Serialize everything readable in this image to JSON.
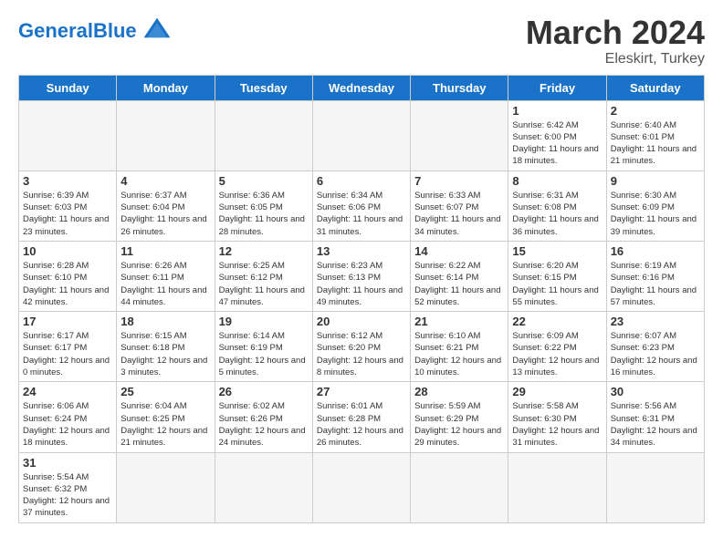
{
  "header": {
    "logo_general": "General",
    "logo_blue": "Blue",
    "month_title": "March 2024",
    "location": "Eleskirt, Turkey"
  },
  "days_of_week": [
    "Sunday",
    "Monday",
    "Tuesday",
    "Wednesday",
    "Thursday",
    "Friday",
    "Saturday"
  ],
  "weeks": [
    [
      {
        "day": "",
        "info": ""
      },
      {
        "day": "",
        "info": ""
      },
      {
        "day": "",
        "info": ""
      },
      {
        "day": "",
        "info": ""
      },
      {
        "day": "",
        "info": ""
      },
      {
        "day": "1",
        "info": "Sunrise: 6:42 AM\nSunset: 6:00 PM\nDaylight: 11 hours and 18 minutes."
      },
      {
        "day": "2",
        "info": "Sunrise: 6:40 AM\nSunset: 6:01 PM\nDaylight: 11 hours and 21 minutes."
      }
    ],
    [
      {
        "day": "3",
        "info": "Sunrise: 6:39 AM\nSunset: 6:03 PM\nDaylight: 11 hours and 23 minutes."
      },
      {
        "day": "4",
        "info": "Sunrise: 6:37 AM\nSunset: 6:04 PM\nDaylight: 11 hours and 26 minutes."
      },
      {
        "day": "5",
        "info": "Sunrise: 6:36 AM\nSunset: 6:05 PM\nDaylight: 11 hours and 28 minutes."
      },
      {
        "day": "6",
        "info": "Sunrise: 6:34 AM\nSunset: 6:06 PM\nDaylight: 11 hours and 31 minutes."
      },
      {
        "day": "7",
        "info": "Sunrise: 6:33 AM\nSunset: 6:07 PM\nDaylight: 11 hours and 34 minutes."
      },
      {
        "day": "8",
        "info": "Sunrise: 6:31 AM\nSunset: 6:08 PM\nDaylight: 11 hours and 36 minutes."
      },
      {
        "day": "9",
        "info": "Sunrise: 6:30 AM\nSunset: 6:09 PM\nDaylight: 11 hours and 39 minutes."
      }
    ],
    [
      {
        "day": "10",
        "info": "Sunrise: 6:28 AM\nSunset: 6:10 PM\nDaylight: 11 hours and 42 minutes."
      },
      {
        "day": "11",
        "info": "Sunrise: 6:26 AM\nSunset: 6:11 PM\nDaylight: 11 hours and 44 minutes."
      },
      {
        "day": "12",
        "info": "Sunrise: 6:25 AM\nSunset: 6:12 PM\nDaylight: 11 hours and 47 minutes."
      },
      {
        "day": "13",
        "info": "Sunrise: 6:23 AM\nSunset: 6:13 PM\nDaylight: 11 hours and 49 minutes."
      },
      {
        "day": "14",
        "info": "Sunrise: 6:22 AM\nSunset: 6:14 PM\nDaylight: 11 hours and 52 minutes."
      },
      {
        "day": "15",
        "info": "Sunrise: 6:20 AM\nSunset: 6:15 PM\nDaylight: 11 hours and 55 minutes."
      },
      {
        "day": "16",
        "info": "Sunrise: 6:19 AM\nSunset: 6:16 PM\nDaylight: 11 hours and 57 minutes."
      }
    ],
    [
      {
        "day": "17",
        "info": "Sunrise: 6:17 AM\nSunset: 6:17 PM\nDaylight: 12 hours and 0 minutes."
      },
      {
        "day": "18",
        "info": "Sunrise: 6:15 AM\nSunset: 6:18 PM\nDaylight: 12 hours and 3 minutes."
      },
      {
        "day": "19",
        "info": "Sunrise: 6:14 AM\nSunset: 6:19 PM\nDaylight: 12 hours and 5 minutes."
      },
      {
        "day": "20",
        "info": "Sunrise: 6:12 AM\nSunset: 6:20 PM\nDaylight: 12 hours and 8 minutes."
      },
      {
        "day": "21",
        "info": "Sunrise: 6:10 AM\nSunset: 6:21 PM\nDaylight: 12 hours and 10 minutes."
      },
      {
        "day": "22",
        "info": "Sunrise: 6:09 AM\nSunset: 6:22 PM\nDaylight: 12 hours and 13 minutes."
      },
      {
        "day": "23",
        "info": "Sunrise: 6:07 AM\nSunset: 6:23 PM\nDaylight: 12 hours and 16 minutes."
      }
    ],
    [
      {
        "day": "24",
        "info": "Sunrise: 6:06 AM\nSunset: 6:24 PM\nDaylight: 12 hours and 18 minutes."
      },
      {
        "day": "25",
        "info": "Sunrise: 6:04 AM\nSunset: 6:25 PM\nDaylight: 12 hours and 21 minutes."
      },
      {
        "day": "26",
        "info": "Sunrise: 6:02 AM\nSunset: 6:26 PM\nDaylight: 12 hours and 24 minutes."
      },
      {
        "day": "27",
        "info": "Sunrise: 6:01 AM\nSunset: 6:28 PM\nDaylight: 12 hours and 26 minutes."
      },
      {
        "day": "28",
        "info": "Sunrise: 5:59 AM\nSunset: 6:29 PM\nDaylight: 12 hours and 29 minutes."
      },
      {
        "day": "29",
        "info": "Sunrise: 5:58 AM\nSunset: 6:30 PM\nDaylight: 12 hours and 31 minutes."
      },
      {
        "day": "30",
        "info": "Sunrise: 5:56 AM\nSunset: 6:31 PM\nDaylight: 12 hours and 34 minutes."
      }
    ],
    [
      {
        "day": "31",
        "info": "Sunrise: 5:54 AM\nSunset: 6:32 PM\nDaylight: 12 hours and 37 minutes."
      },
      {
        "day": "",
        "info": ""
      },
      {
        "day": "",
        "info": ""
      },
      {
        "day": "",
        "info": ""
      },
      {
        "day": "",
        "info": ""
      },
      {
        "day": "",
        "info": ""
      },
      {
        "day": "",
        "info": ""
      }
    ]
  ]
}
